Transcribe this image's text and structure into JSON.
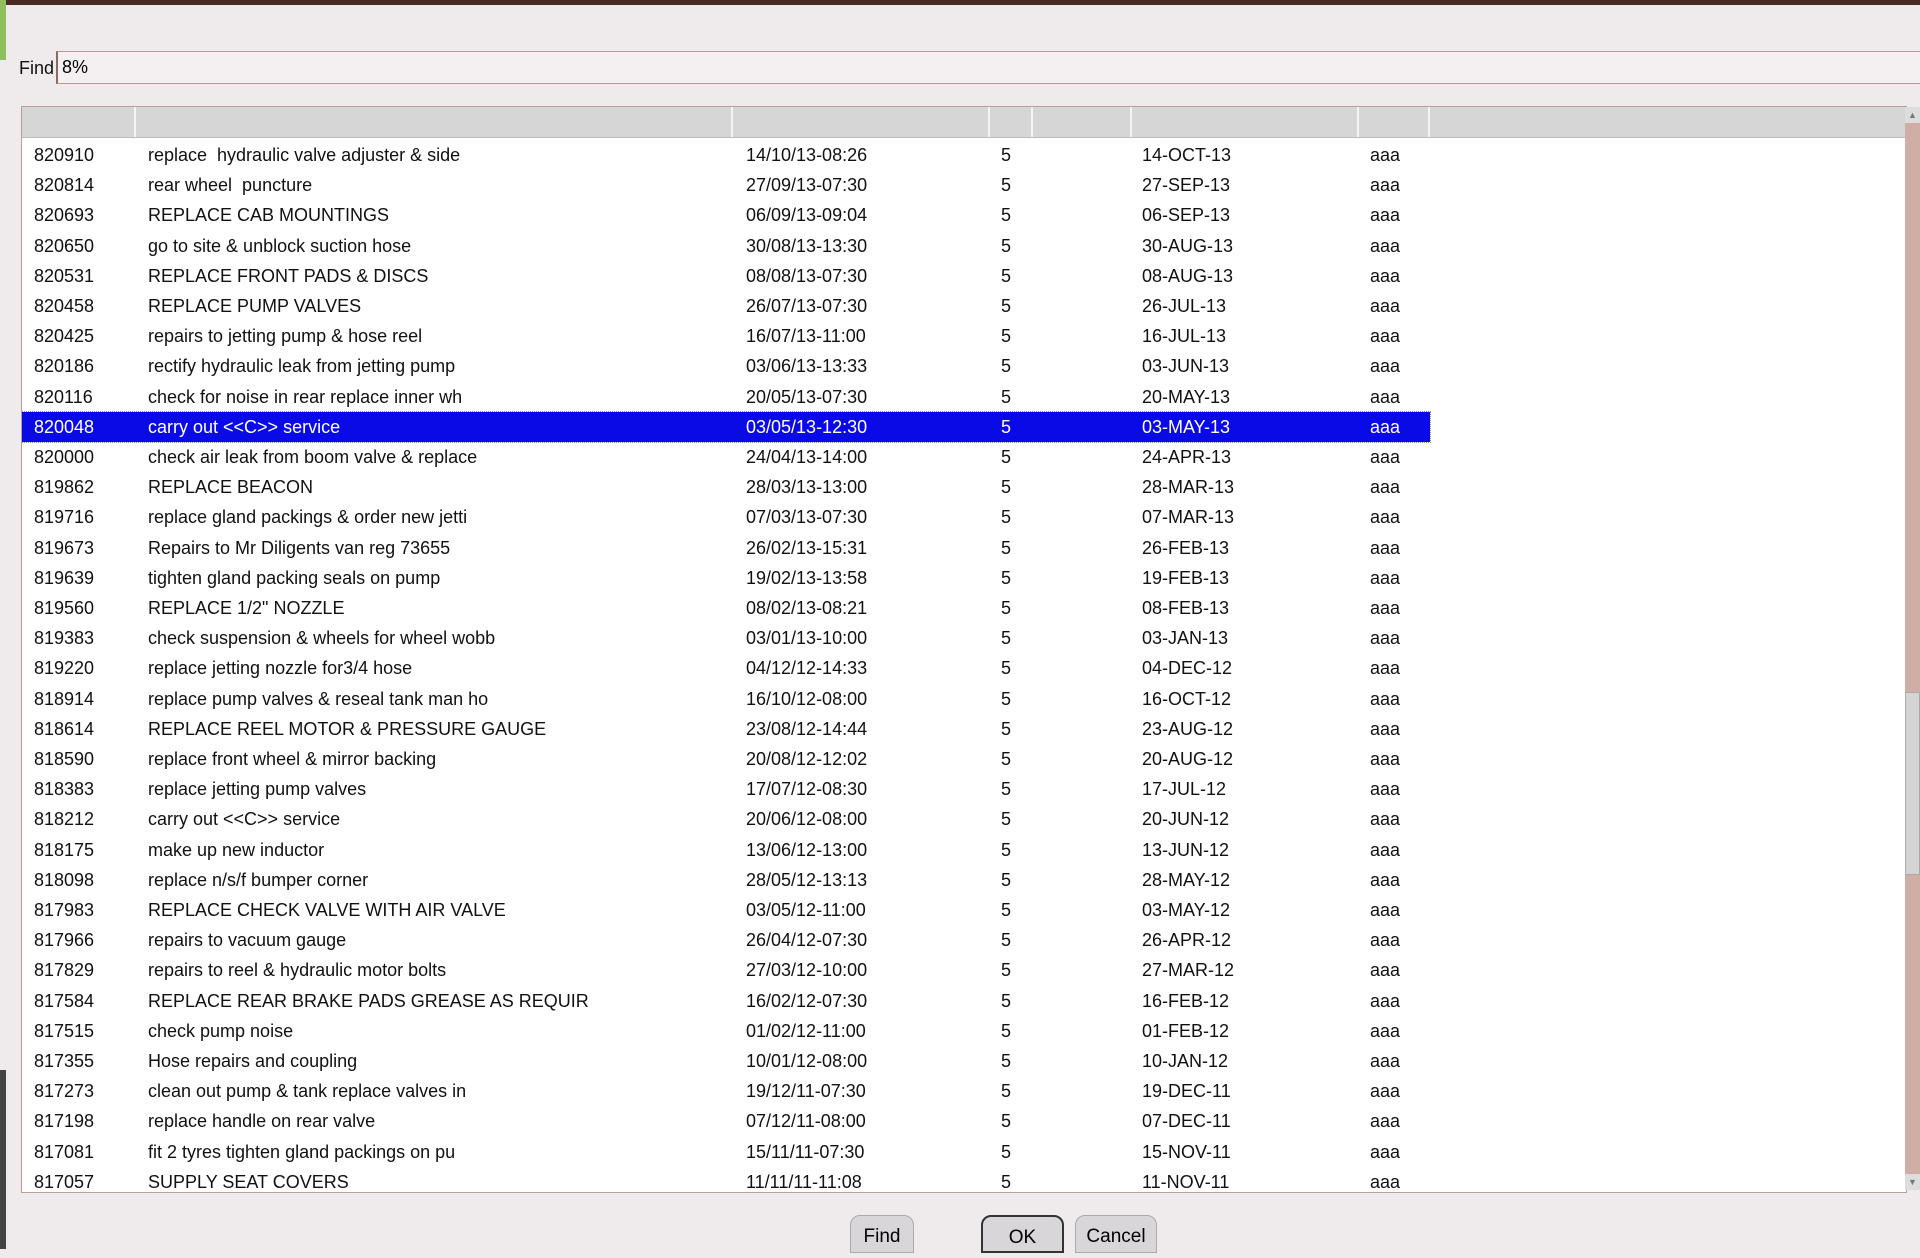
{
  "find": {
    "label": "Find",
    "value": "8%"
  },
  "table": {
    "columns": [
      "",
      "",
      "",
      "",
      "",
      "",
      ""
    ],
    "selected_index": 9,
    "rows": [
      [
        "820910",
        "replace  hydraulic valve adjuster & side",
        "14/10/13-08:26",
        "5",
        "14-OCT-13",
        "aaa"
      ],
      [
        "820814",
        "rear wheel  puncture",
        "27/09/13-07:30",
        "5",
        "27-SEP-13",
        "aaa"
      ],
      [
        "820693",
        "REPLACE CAB MOUNTINGS",
        "06/09/13-09:04",
        "5",
        "06-SEP-13",
        "aaa"
      ],
      [
        "820650",
        "go to site & unblock suction hose",
        "30/08/13-13:30",
        "5",
        "30-AUG-13",
        "aaa"
      ],
      [
        "820531",
        "REPLACE FRONT PADS & DISCS",
        "08/08/13-07:30",
        "5",
        "08-AUG-13",
        "aaa"
      ],
      [
        "820458",
        "REPLACE PUMP VALVES",
        "26/07/13-07:30",
        "5",
        "26-JUL-13",
        "aaa"
      ],
      [
        "820425",
        "repairs to jetting pump & hose reel",
        "16/07/13-11:00",
        "5",
        "16-JUL-13",
        "aaa"
      ],
      [
        "820186",
        "rectify hydraulic leak from jetting pump",
        "03/06/13-13:33",
        "5",
        "03-JUN-13",
        "aaa"
      ],
      [
        "820116",
        "check for noise in rear replace inner wh",
        "20/05/13-07:30",
        "5",
        "20-MAY-13",
        "aaa"
      ],
      [
        "820048",
        "carry out <<C>> service",
        "03/05/13-12:30",
        "5",
        "03-MAY-13",
        "aaa"
      ],
      [
        "820000",
        "check air leak from boom valve & replace",
        "24/04/13-14:00",
        "5",
        "24-APR-13",
        "aaa"
      ],
      [
        "819862",
        "REPLACE BEACON",
        "28/03/13-13:00",
        "5",
        "28-MAR-13",
        "aaa"
      ],
      [
        "819716",
        "replace gland packings & order new jetti",
        "07/03/13-07:30",
        "5",
        "07-MAR-13",
        "aaa"
      ],
      [
        "819673",
        "Repairs to Mr Diligents van reg 73655",
        "26/02/13-15:31",
        "5",
        "26-FEB-13",
        "aaa"
      ],
      [
        "819639",
        "tighten gland packing seals on pump",
        "19/02/13-13:58",
        "5",
        "19-FEB-13",
        "aaa"
      ],
      [
        "819560",
        "REPLACE 1/2\" NOZZLE",
        "08/02/13-08:21",
        "5",
        "08-FEB-13",
        "aaa"
      ],
      [
        "819383",
        "check suspension & wheels for wheel wobb",
        "03/01/13-10:00",
        "5",
        "03-JAN-13",
        "aaa"
      ],
      [
        "819220",
        "replace jetting nozzle for3/4 hose",
        "04/12/12-14:33",
        "5",
        "04-DEC-12",
        "aaa"
      ],
      [
        "818914",
        "replace pump valves & reseal tank man ho",
        "16/10/12-08:00",
        "5",
        "16-OCT-12",
        "aaa"
      ],
      [
        "818614",
        "REPLACE REEL MOTOR & PRESSURE GAUGE",
        "23/08/12-14:44",
        "5",
        "23-AUG-12",
        "aaa"
      ],
      [
        "818590",
        "replace front wheel & mirror backing",
        "20/08/12-12:02",
        "5",
        "20-AUG-12",
        "aaa"
      ],
      [
        "818383",
        "replace jetting pump valves",
        "17/07/12-08:30",
        "5",
        "17-JUL-12",
        "aaa"
      ],
      [
        "818212",
        "carry out <<C>> service",
        "20/06/12-08:00",
        "5",
        "20-JUN-12",
        "aaa"
      ],
      [
        "818175",
        "make up new inductor",
        "13/06/12-13:00",
        "5",
        "13-JUN-12",
        "aaa"
      ],
      [
        "818098",
        "replace n/s/f bumper corner",
        "28/05/12-13:13",
        "5",
        "28-MAY-12",
        "aaa"
      ],
      [
        "817983",
        "REPLACE CHECK VALVE WITH AIR VALVE",
        "03/05/12-11:00",
        "5",
        "03-MAY-12",
        "aaa"
      ],
      [
        "817966",
        "repairs to vacuum gauge",
        "26/04/12-07:30",
        "5",
        "26-APR-12",
        "aaa"
      ],
      [
        "817829",
        "repairs to reel & hydraulic motor bolts",
        "27/03/12-10:00",
        "5",
        "27-MAR-12",
        "aaa"
      ],
      [
        "817584",
        "REPLACE REAR BRAKE PADS GREASE AS REQUIR",
        "16/02/12-07:30",
        "5",
        "16-FEB-12",
        "aaa"
      ],
      [
        "817515",
        "check pump noise",
        "01/02/12-11:00",
        "5",
        "01-FEB-12",
        "aaa"
      ],
      [
        "817355",
        "Hose repairs and coupling",
        "10/01/12-08:00",
        "5",
        "10-JAN-12",
        "aaa"
      ],
      [
        "817273",
        "clean out pump & tank replace valves in",
        "19/12/11-07:30",
        "5",
        "19-DEC-11",
        "aaa"
      ],
      [
        "817198",
        "replace handle on rear valve",
        "07/12/11-08:00",
        "5",
        "07-DEC-11",
        "aaa"
      ],
      [
        "817081",
        "fit 2 tyres tighten gland packings on pu",
        "15/11/11-07:30",
        "5",
        "15-NOV-11",
        "aaa"
      ],
      [
        "817057",
        "SUPPLY SEAT COVERS",
        "11/11/11-11:08",
        "5",
        "11-NOV-11",
        "aaa"
      ]
    ]
  },
  "buttons": {
    "find": "Find",
    "ok": "OK",
    "cancel": "Cancel"
  },
  "colors": {
    "selection": "#0a0ae6",
    "scroll_track": "#cfaea6"
  }
}
